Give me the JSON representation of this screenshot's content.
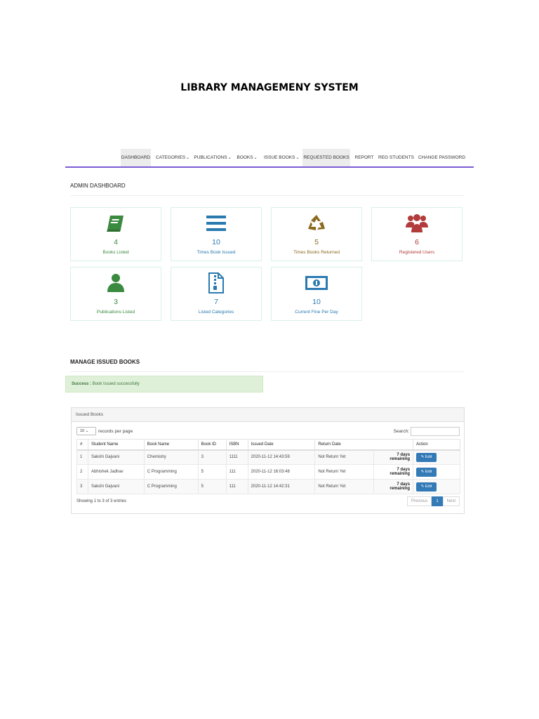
{
  "document": {
    "title": "LIBRARY MANAGEMENY SYSTEM"
  },
  "nav": {
    "items": [
      {
        "label": "DASHBOARD",
        "caret": ""
      },
      {
        "label": "CATEGORIES",
        "caret": "⌄"
      },
      {
        "label": "PUBLICATIONS",
        "caret": "⌄"
      },
      {
        "label": "BOOKS",
        "caret": "⌄"
      },
      {
        "label": "ISSUE BOOKS",
        "caret": "⌄"
      },
      {
        "label": "REQUESTED BOOKS",
        "caret": ""
      },
      {
        "label": "REPORT",
        "caret": ""
      },
      {
        "label": "REG STUDENTS",
        "caret": ""
      },
      {
        "label": "CHANGE PASSWORD",
        "caret": ""
      }
    ],
    "accent": "#7b5cd6"
  },
  "dashboard": {
    "title": "ADMIN DASHBOARD",
    "cards": [
      {
        "icon": "book-icon",
        "value": "4",
        "label": "Books Listed",
        "color": "#3a8a3f"
      },
      {
        "icon": "bars-icon",
        "value": "10",
        "label": "Times Book Issued",
        "color": "#2a7ab0"
      },
      {
        "icon": "recycle-icon",
        "value": "5",
        "label": "Times Books Returned",
        "color": "#8b6a1e"
      },
      {
        "icon": "users-icon",
        "value": "6",
        "label": "Registered Users",
        "color": "#b23b3b"
      },
      {
        "icon": "user-icon",
        "value": "3",
        "label": "Publications Listed",
        "color": "#3a8a3f"
      },
      {
        "icon": "file-archive-icon",
        "value": "7",
        "label": "Listed Categories",
        "color": "#2a7ab0"
      },
      {
        "icon": "money-icon",
        "value": "10",
        "label": "Current Fine Per Day",
        "color": "#2a7ab0"
      }
    ]
  },
  "manage": {
    "title": "MANAGE ISSUED BOOKS",
    "alert": {
      "strong": "Success :",
      "text": "Book Issued successfully"
    }
  },
  "panel": {
    "heading": "Issued Books",
    "length": {
      "value": "10",
      "caret": "⌄",
      "suffix": "records per page"
    },
    "search_label": "Search:",
    "columns": [
      "#",
      "Student Name",
      "Book Name",
      "Book ID",
      "ISBN",
      "Issued Date",
      "Return Date",
      "",
      "Action"
    ],
    "rows": [
      [
        "1",
        "Sakshi Gajvani",
        "Chemistry",
        "3",
        "1111",
        "2020-11-12 14:43:59",
        "Not Return Yet",
        "7 days remaining",
        "✎ Edit"
      ],
      [
        "2",
        "Abhishek Jadhav",
        "C Programming",
        "5",
        "111",
        "2020-11-12 16:03:48",
        "Not Return Yet",
        "7 days remaining",
        "✎ Edit"
      ],
      [
        "3",
        "Sakshi Gajvani",
        "C Programming",
        "5",
        "111",
        "2020-11-12 14:42:31",
        "Not Return Yet",
        "7 days remaining",
        "✎ Edit"
      ]
    ],
    "info": "Showing 1 to 3 of 3 entries",
    "pager": {
      "prev": "Previous",
      "current": "1",
      "next": "Next"
    }
  }
}
